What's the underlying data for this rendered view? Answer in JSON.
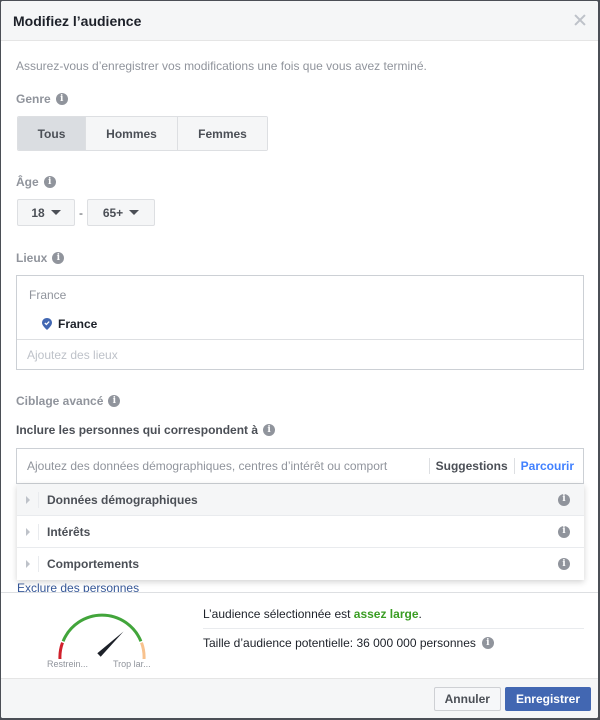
{
  "dialog": {
    "title": "Modifiez l’audience",
    "intro": "Assurez-vous d’enregistrer vos modifications une fois que vous avez terminé."
  },
  "gender": {
    "label": "Genre",
    "options": [
      {
        "label": "Tous",
        "selected": true
      },
      {
        "label": "Hommes",
        "selected": false
      },
      {
        "label": "Femmes",
        "selected": false
      }
    ]
  },
  "age": {
    "label": "Âge",
    "min": "18",
    "separator": "-",
    "max": "65+"
  },
  "locations": {
    "label": "Lieux",
    "group": "France",
    "items": [
      {
        "name": "France",
        "icon": "location-pin-icon"
      }
    ],
    "placeholder": "Ajoutez des lieux"
  },
  "detailed_targeting": {
    "label": "Ciblage avancé",
    "include_label": "Inclure les personnes qui correspondent à",
    "placeholder": "Ajoutez des données démographiques, centres d’intérêt ou comport",
    "suggestions_label": "Suggestions",
    "browse_label": "Parcourir",
    "categories": [
      {
        "label": "Données démographiques"
      },
      {
        "label": "Intérêts"
      },
      {
        "label": "Comportements"
      }
    ],
    "exclude_label": "Exclure des personnes"
  },
  "audience": {
    "gauge_min_label": "Restrein...",
    "gauge_max_label": "Trop lar...",
    "gauge_level": 0.72,
    "status_prefix": "L’audience sélectionnée est ",
    "status_value": "assez large",
    "status_suffix": ".",
    "size_text": "Taille d’audience potentielle: 36 000 000 personnes",
    "colors": {
      "narrow": "#d0202b",
      "good": "#42a53b",
      "broad": "#f8c28e",
      "status": "#3a9d23"
    }
  },
  "footer": {
    "cancel_label": "Annuler",
    "save_label": "Enregistrer"
  },
  "icons": {
    "info_glyph": "i"
  }
}
